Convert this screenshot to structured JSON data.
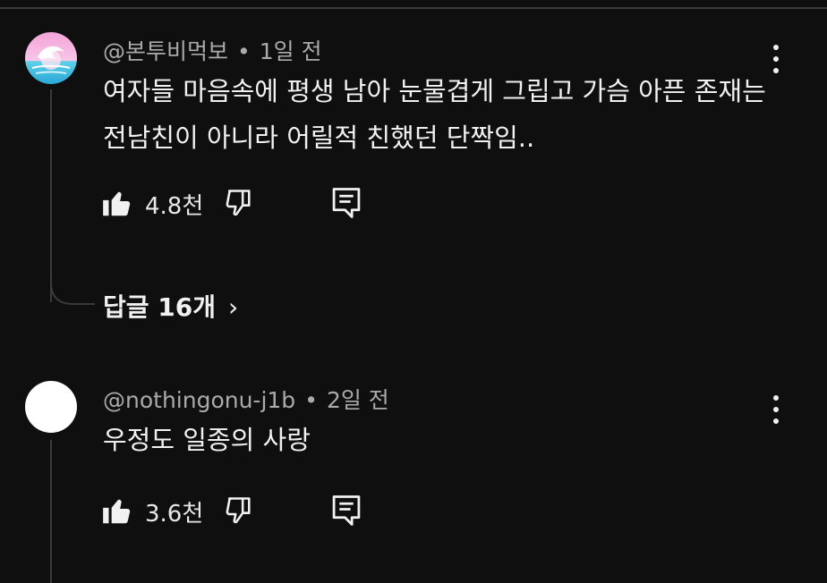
{
  "comments": [
    {
      "author": "@본투비먹보",
      "time": "1일 전",
      "text": "여자들 마음속에 평생 남아 눈물겹게 그립고 가슴 아픈 존재는 전남친이 아니라 어릴적 친했던 단짝임..",
      "likes": "4.8천",
      "replies_label": "답글 16개",
      "replies_chevron": "›",
      "avatar": "dolphin-sunset"
    },
    {
      "author": "@nothingonu-j1b",
      "time": "2일 전",
      "text": "우정도 일종의 사랑",
      "likes": "3.6천",
      "avatar": "plain-white"
    }
  ],
  "separator": "•",
  "icons": {
    "like": "thumbs-up-filled-icon",
    "dislike": "thumbs-down-outline-icon",
    "reply": "comment-reply-icon",
    "menu": "kebab-menu-icon"
  },
  "colors": {
    "background": "#0f0f0f",
    "text": "#f1f1f1",
    "meta": "#aaaaaa",
    "thread_line": "#3a3a3a"
  }
}
